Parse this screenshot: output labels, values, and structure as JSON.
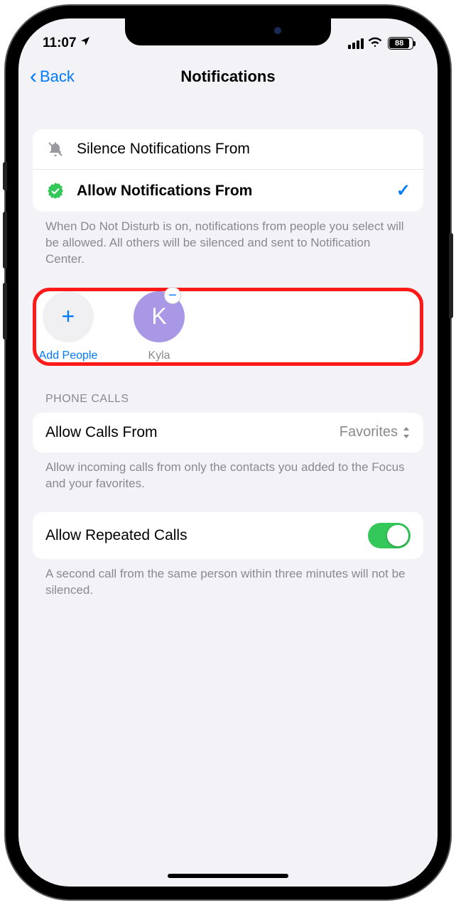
{
  "status": {
    "time": "11:07",
    "battery_pct": "88"
  },
  "nav": {
    "back": "Back",
    "title": "Notifications"
  },
  "mode": {
    "silence_label": "Silence Notifications From",
    "allow_label": "Allow Notifications From",
    "footer": "When Do Not Disturb is on, notifications from people you select will be allowed. All others will be silenced and sent to Notification Center."
  },
  "people": {
    "add_label": "Add People",
    "contacts": [
      {
        "initial": "K",
        "name": "Kyla"
      }
    ]
  },
  "calls": {
    "section_header": "PHONE CALLS",
    "allow_from_label": "Allow Calls From",
    "allow_from_value": "Favorites",
    "allow_from_footer": "Allow incoming calls from only the contacts you added to the Focus and your favorites.",
    "repeated_label": "Allow Repeated Calls",
    "repeated_on": true,
    "repeated_footer": "A second call from the same person within three minutes will not be silenced."
  }
}
